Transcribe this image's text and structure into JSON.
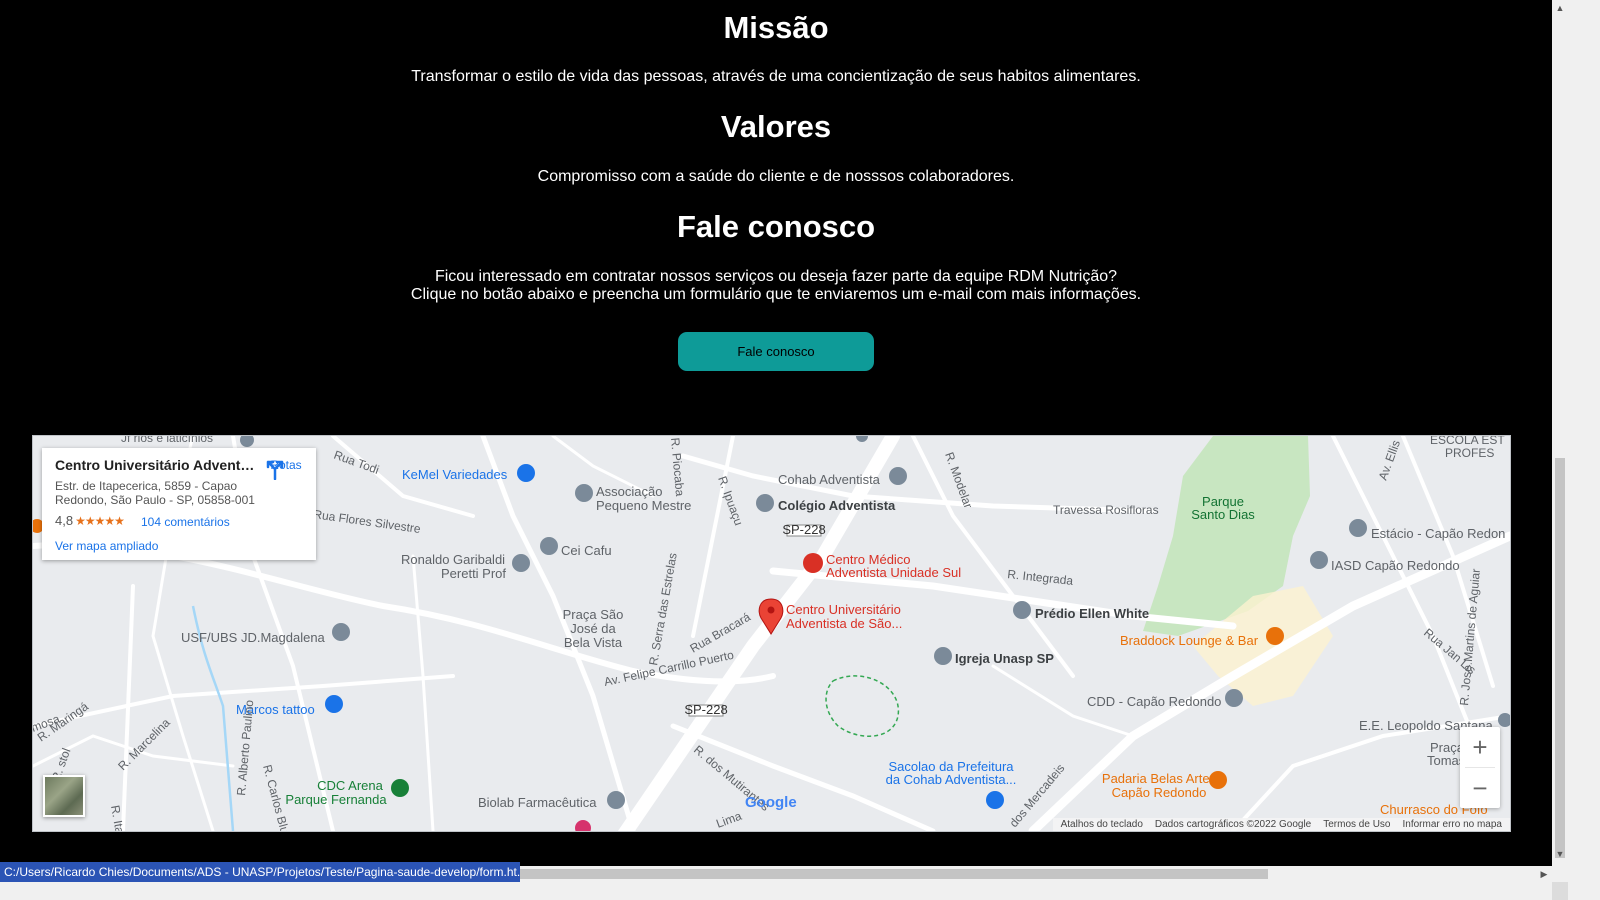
{
  "mission": {
    "heading": "Missão",
    "text": "Transformar o estilo de vida das pessoas, através de uma concientização de seus habitos alimentares."
  },
  "values": {
    "heading": "Valores",
    "text": "Compromisso com a saúde do cliente e de nosssos colaboradores."
  },
  "contact": {
    "heading": "Fale conosco",
    "line1": "Ficou interessado em contratar nossos serviços ou deseja fazer parte da equipe RDM Nutrição?",
    "line2": "Clique no botão abaixo e preencha um formulário que te enviaremos um e-mail com mais informações.",
    "button_label": "Fale conosco"
  },
  "map": {
    "card": {
      "title": "Centro Universitário Adventist...",
      "address": "Estr. de Itapecerica, 5859 - Capao Redondo, São Paulo - SP, 05858-001",
      "rating": "4,8",
      "reviews": "104 comentários",
      "larger_map": "Ver mapa ampliado",
      "directions": "Rotas"
    },
    "labels": {
      "jf": "Jf rios e laticínios",
      "kemel": "KeMel Variedades",
      "assoc1": "Associação",
      "assoc2": "Pequeno Mestre",
      "cohab": "Cohab Adventista",
      "colegio": "Colégio Adventista",
      "sp228a": "SP-228",
      "sp228b": "SP-228",
      "travessa": "Travessa Rosifloras",
      "parque1": "Parque",
      "parque2": "Santo Dias",
      "estacio": "Estácio - Capão Redon",
      "escola1": "ESCOLA EST",
      "escola2": "PROFES",
      "iasd": "IASD Capão Redondo",
      "flores": "Rua Flores Silvestre",
      "todi": "Rua Todi",
      "cei": "Cei Cafu",
      "ronaldo1": "Ronaldo Garibaldi",
      "ronaldo2": "Peretti Prof",
      "cms1": "Centro Médico",
      "cms2": "Adventista Unidade Sul",
      "integrada": "R. Integrada",
      "unasp1": "Centro Universitário",
      "unasp2": "Adventista de São...",
      "ellen": "Prédio Ellen White",
      "praca1": "Praça São",
      "praca2": "José da",
      "praca3": "Bela Vista",
      "usf": "USF/UBS JD.Magdalena",
      "serra": "R. Serra das Estrelas",
      "bracara": "Rua Bracará",
      "felipe": "Av. Felipe Carrillo Puerto",
      "igreja": "Igreja Unasp SP",
      "braddock": "Braddock Lounge & Bar",
      "janlis": "Rua Jan Lis",
      "jose": "R. José Martins de Aguiar",
      "ellis": "Av. Ellis",
      "modelar": "R. Modelar",
      "ipuacu": "R. Ipuaçu",
      "dpiocaba": "R. Piocaba",
      "marcos": "Marcos tattoo",
      "cdd": "CDD - Capão Redondo",
      "leopoldo": "E.E. Leopoldo Santana",
      "praca_t1": "Praça",
      "praca_t2": "Tomas",
      "maringa": "R. Maringá",
      "mosa": "mosa",
      "marcelina": "R. Marcelina",
      "alberto": "R. Alberto Paulino",
      "carlos": "R. Carlos Blum",
      "itapeti": "R. Itapeti",
      "cdc1": "CDC Arena",
      "cdc2": "Parque Fernanda",
      "biolab": "Biolab Farmacêutica",
      "mutirantes": "R. dos Mutirantes",
      "sacolao1": "Sacolao da Prefeitura",
      "sacolao2": "da Cohab Adventista...",
      "padaria1": "Padaria Belas Artes",
      "padaria2": "Capão Redondo",
      "churrasco": "Churrasco do Fofo",
      "mercadeis": "dos Mercadeis",
      "lima": "Lima",
      "rstol": "R. stol"
    },
    "logo": "Google",
    "attribution": {
      "shortcuts": "Atalhos do teclado",
      "data": "Dados cartográficos ©2022 Google",
      "terms": "Termos de Uso",
      "report": "Informar erro no mapa"
    },
    "zoom_in": "+",
    "zoom_out": "−"
  },
  "status_bar": {
    "url": "C:/Users/Ricardo Chies/Documents/ADS - UNASP/Projetos/Teste/Pagina-saude-develop/form.ht..."
  },
  "colors": {
    "background": "#000000",
    "button": "#0e9b98",
    "link": "#1a73e8",
    "poi_red": "#d93025",
    "poi_orange": "#e8710a",
    "poi_blue": "#1a73e8",
    "poi_green": "#188038",
    "park_green": "#c8e6c1"
  },
  "icons": [
    "directions-icon",
    "star-icon",
    "school-icon",
    "hospital-icon",
    "location-pin-icon",
    "bar-icon",
    "restaurant-icon",
    "shopping-icon",
    "zoom-in-icon",
    "zoom-out-icon"
  ]
}
